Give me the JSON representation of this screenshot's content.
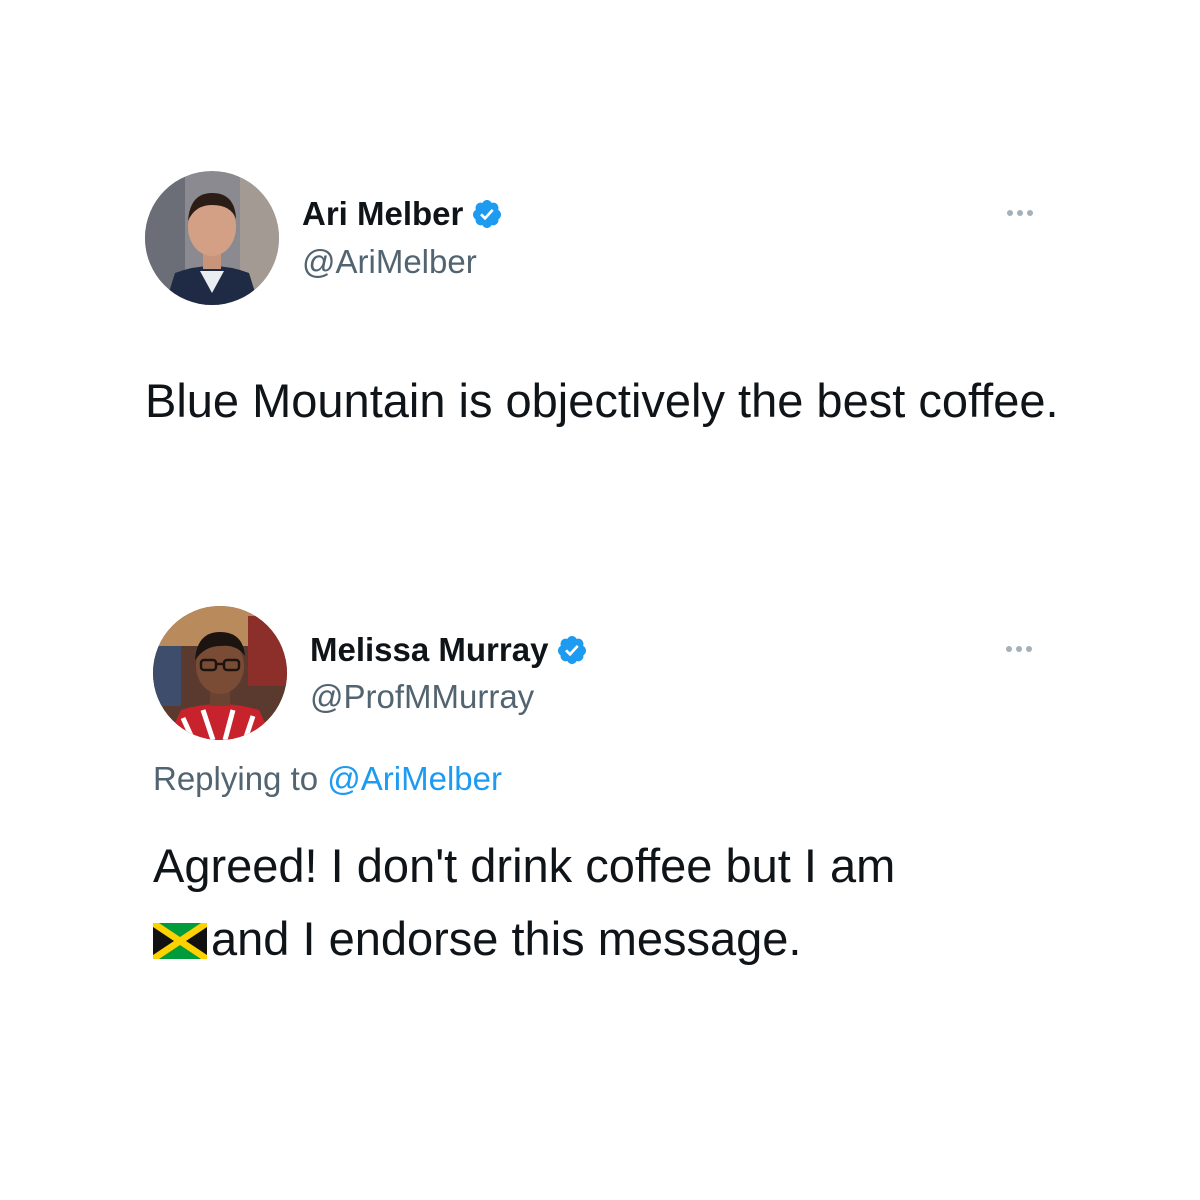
{
  "tweets": [
    {
      "display_name": "Ari Melber",
      "handle": "@AriMelber",
      "verified": true,
      "text": "Blue Mountain is objectively the best coffee."
    },
    {
      "display_name": "Melissa Murray",
      "handle": "@ProfMMurray",
      "verified": true,
      "reply_prefix": "Replying to",
      "reply_handle": "@AriMelber",
      "text_line_1": "Agreed! I don't drink coffee but I am",
      "flag_emoji": "jamaica-flag-icon",
      "text_line_2": "and I endorse this message."
    }
  ],
  "colors": {
    "text_primary": "#0f1419",
    "text_secondary": "#536471",
    "accent": "#1d9bf0",
    "verified_badge": "#1d9bf0",
    "background": "#ffffff"
  }
}
